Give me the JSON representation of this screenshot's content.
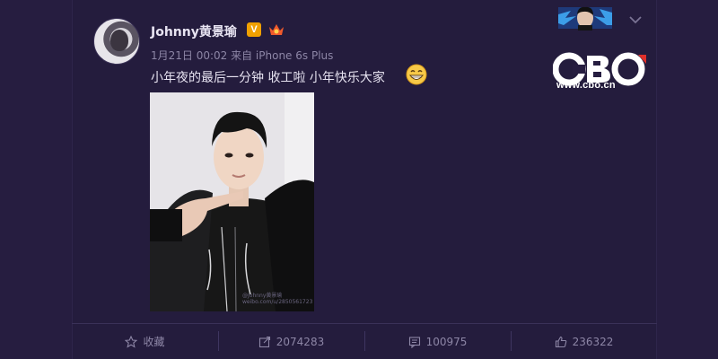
{
  "post": {
    "username": "Johnny黄景瑜",
    "verified_badge": "V",
    "vip_icon": "vip-crown-icon",
    "meta": "1月21日 00:02 来自 iPhone 6s Plus",
    "text": "小年夜的最后一分钟 收工啦 小年快乐大家",
    "emoji": "grinning-emoji",
    "image_watermark_line1": "@Johnny黄景瑜",
    "image_watermark_line2": "weibo.com/u/2850561723"
  },
  "actions": [
    {
      "icon": "star-icon",
      "label": "收藏"
    },
    {
      "icon": "share-icon",
      "label": "2074283"
    },
    {
      "icon": "comment-icon",
      "label": "100975"
    },
    {
      "icon": "thumbs-up-icon",
      "label": "236322"
    }
  ],
  "watermark": {
    "logo": "CBO",
    "url": "www.cbo.cn"
  },
  "colors": {
    "background": "#261d40",
    "card": "#241c3d",
    "verified": "#f0a000",
    "text": "#e6e2f0",
    "muted": "#8d86a6"
  }
}
